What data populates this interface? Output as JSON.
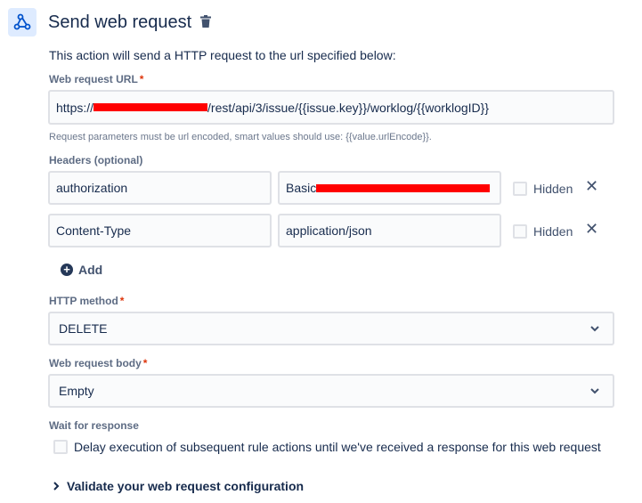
{
  "header": {
    "icon": "webhook-icon",
    "title": "Send web request",
    "delete_icon": "trash-icon"
  },
  "description": "This action will send a HTTP request to the url specified below:",
  "url_field": {
    "label": "Web request URL",
    "required_mark": "*",
    "value_prefix": "https://",
    "value_suffix": "/rest/api/3/issue/{{issue.key}}/worklog/{{worklogID}}",
    "help": "Request parameters must be url encoded, smart values should use: {{value.urlEncode}}."
  },
  "headers": {
    "label": "Headers (optional)",
    "rows": [
      {
        "name": "authorization",
        "value": "Basic ",
        "hidden_label": "Hidden",
        "hidden_checked": false
      },
      {
        "name": "Content-Type",
        "value": "application/json",
        "hidden_label": "Hidden",
        "hidden_checked": false
      }
    ],
    "remove_glyph": "✕",
    "add_label": "Add",
    "add_glyph": "+"
  },
  "http_method": {
    "label": "HTTP method",
    "required_mark": "*",
    "value": "DELETE"
  },
  "body": {
    "label": "Web request body",
    "required_mark": "*",
    "value": "Empty"
  },
  "wait": {
    "label": "Wait for response",
    "checkbox_label": "Delay execution of subsequent rule actions until we've received a response for this web request",
    "checked": false
  },
  "validate": {
    "label": "Validate your web request configuration"
  },
  "colors": {
    "accent": "#0052cc",
    "required": "#de350b",
    "redaction": "#ff0000"
  }
}
